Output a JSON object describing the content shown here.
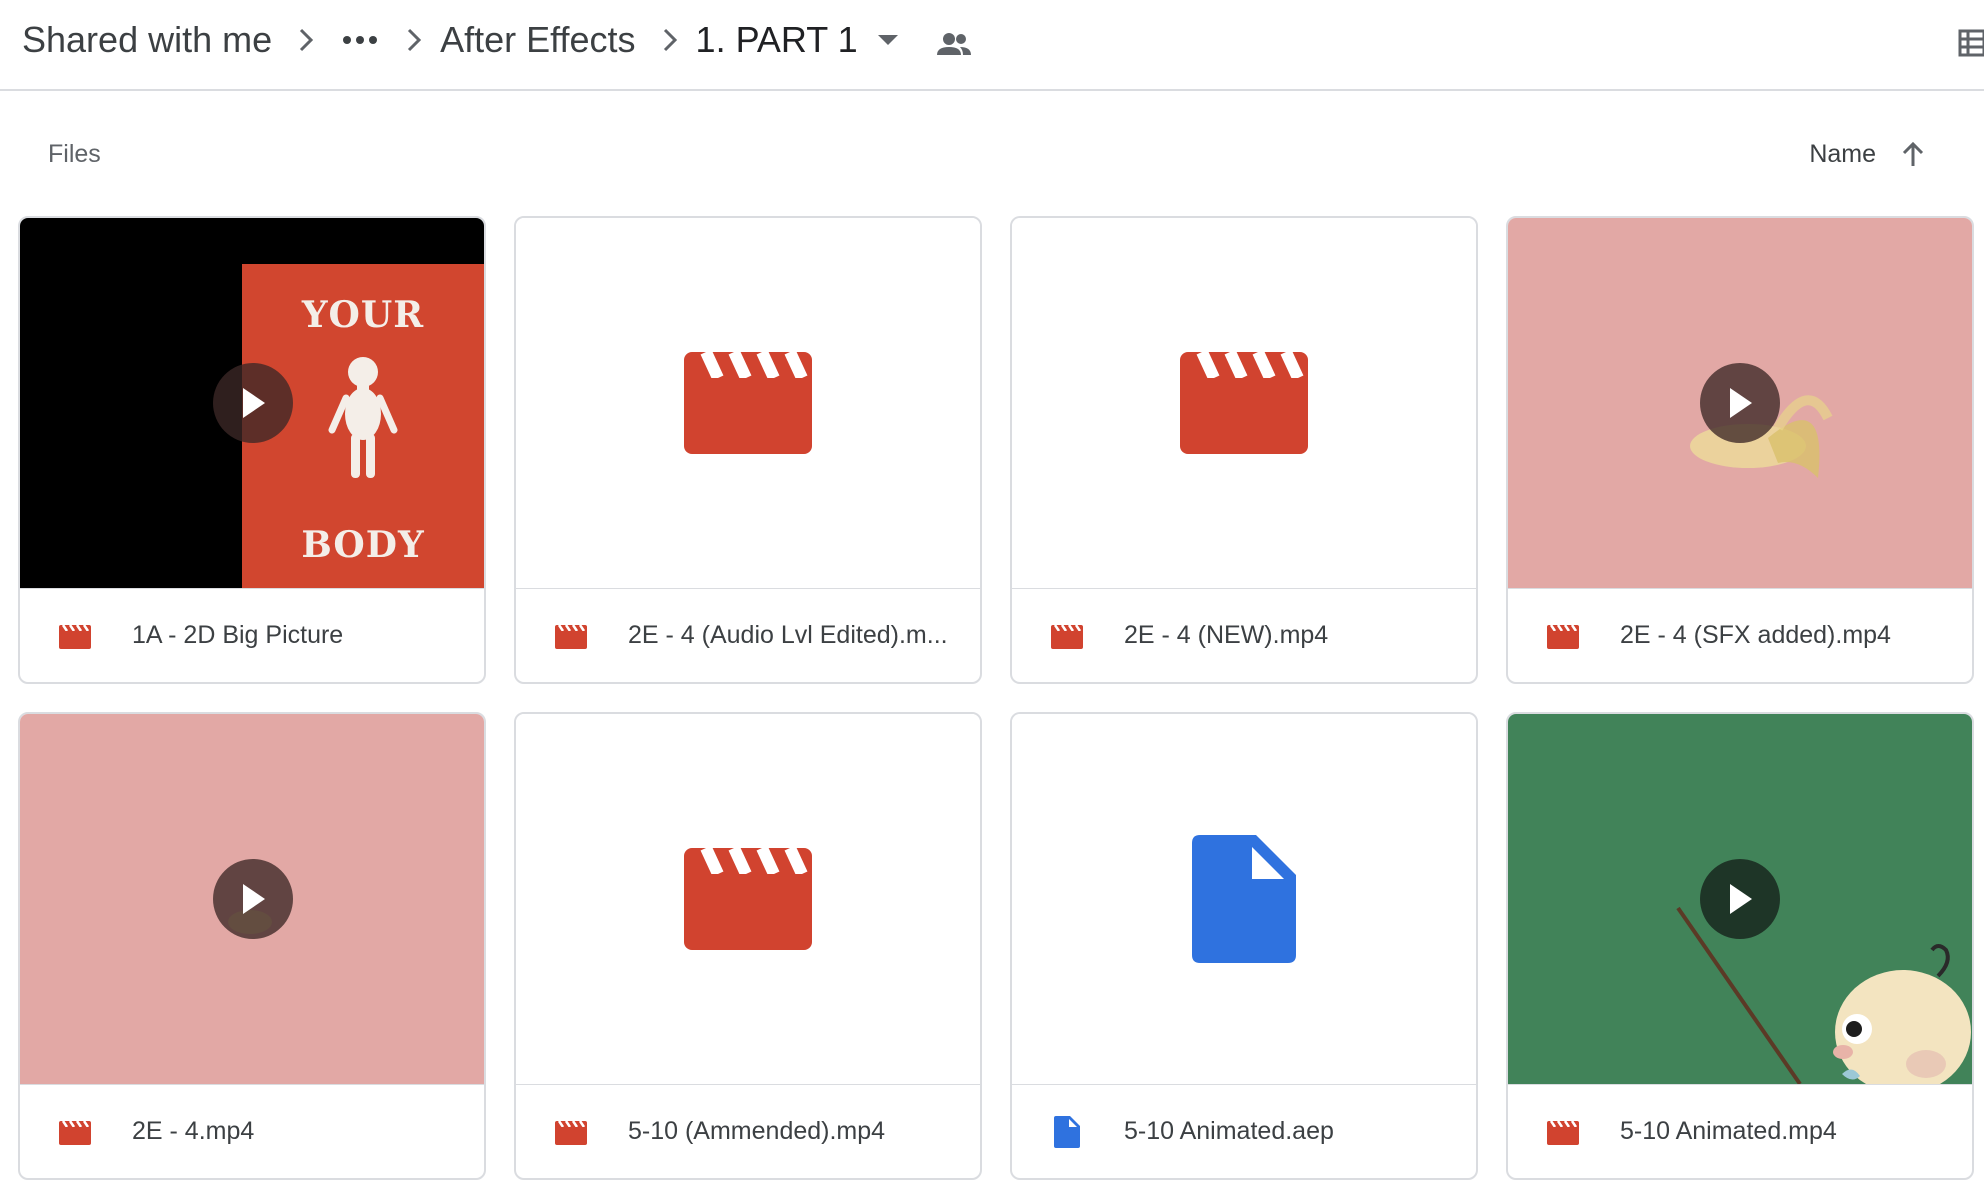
{
  "breadcrumb": {
    "root": "Shared with me",
    "more": "•••",
    "folder": "After Effects",
    "current": "1. PART 1"
  },
  "section": {
    "title": "Files"
  },
  "sort": {
    "label": "Name",
    "direction": "ascending"
  },
  "colors": {
    "video": "#d1432f",
    "document": "#2f72df",
    "pink_thumb": "#e2a8a5",
    "green_thumb": "#418359"
  },
  "files": [
    {
      "name": "1A - 2D Big Picture",
      "type": "video",
      "thumb_text_top": "YOUR",
      "thumb_text_bottom": "BODY"
    },
    {
      "name": "2E - 4 (Audio Lvl Edited).m...",
      "type": "video"
    },
    {
      "name": "2E - 4 (NEW).mp4",
      "type": "video"
    },
    {
      "name": "2E - 4 (SFX added).mp4",
      "type": "video"
    },
    {
      "name": "2E - 4.mp4",
      "type": "video"
    },
    {
      "name": "5-10 (Ammended).mp4",
      "type": "video"
    },
    {
      "name": "5-10 Animated.aep",
      "type": "document"
    },
    {
      "name": "5-10 Animated.mp4",
      "type": "video"
    }
  ]
}
